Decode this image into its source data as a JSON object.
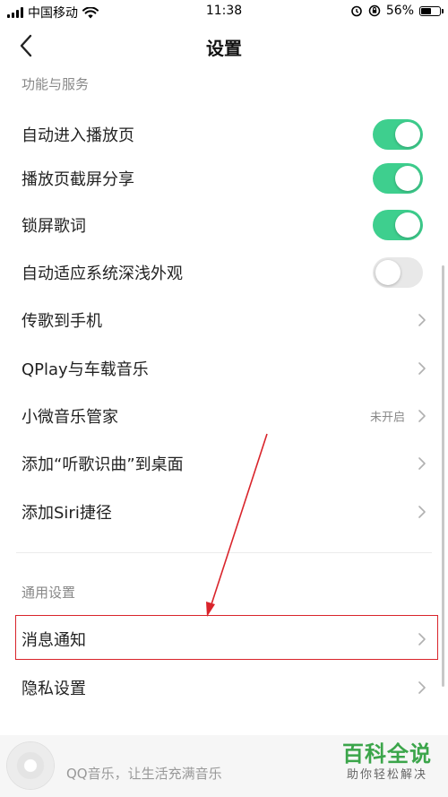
{
  "status_bar": {
    "carrier": "中国移动",
    "time": "11:38",
    "battery_percent": "56%",
    "battery_level": 0.56,
    "icons": [
      "signal-icon",
      "wifi-icon",
      "alarm-icon",
      "orientation-lock-icon",
      "battery-icon"
    ]
  },
  "nav": {
    "title": "设置",
    "back_icon": "chevron-left-icon"
  },
  "sections": {
    "features": {
      "header": "功能与服务",
      "items": [
        {
          "label": "自动进入播放页",
          "type": "toggle",
          "on": true
        },
        {
          "label": "播放页截屏分享",
          "type": "toggle",
          "on": true
        },
        {
          "label": "锁屏歌词",
          "type": "toggle",
          "on": true
        },
        {
          "label": "自动适应系统深浅外观",
          "type": "toggle",
          "on": false
        },
        {
          "label": "传歌到手机",
          "type": "link"
        },
        {
          "label": "QPlay与车载音乐",
          "type": "link"
        },
        {
          "label": "小微音乐管家",
          "type": "link",
          "value": "未开启"
        },
        {
          "label": "添加“听歌识曲”到桌面",
          "type": "link"
        },
        {
          "label": "添加Siri捷径",
          "type": "link"
        }
      ]
    },
    "general": {
      "header": "通用设置",
      "items": [
        {
          "label": "消息通知",
          "type": "link",
          "highlighted": true
        },
        {
          "label": "隐私设置",
          "type": "link"
        }
      ]
    }
  },
  "player": {
    "tagline": "QQ音乐，让生活充满音乐"
  },
  "watermark": {
    "main": "百科全说",
    "sub": "助你轻松解决"
  },
  "colors": {
    "toggle_on": "#3ecf8e",
    "toggle_off": "#e8e8e8",
    "highlight": "#d9242b",
    "watermark": "#3ba54a"
  }
}
